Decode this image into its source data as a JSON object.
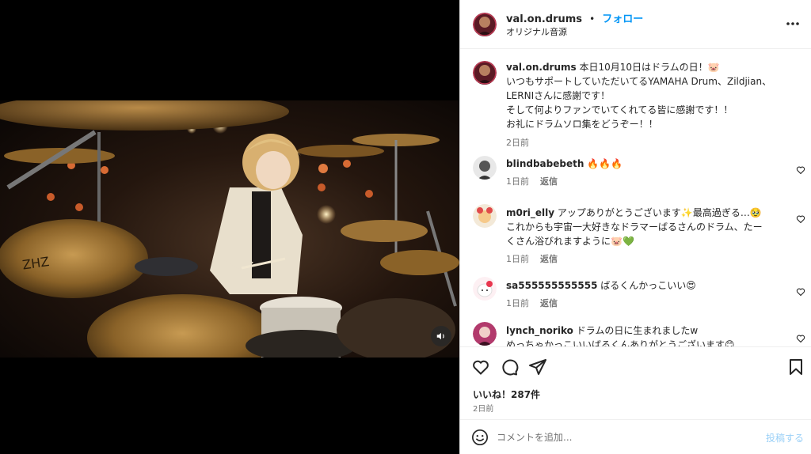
{
  "header": {
    "username": "val.on.drums",
    "dot": "•",
    "follow_label": "フォロー",
    "audio_label": "オリジナル音源"
  },
  "caption": {
    "username": "val.on.drums",
    "lines": [
      "本日10月10日はドラムの日！🐷",
      "いつもサポートしていただいてるYAMAHA Drum、Zildjian、",
      "LERNIさんに感謝です！",
      "そして何よりファンでいてくれてる皆に感謝です！！",
      "お礼にドラムソロ集をどうぞー！！"
    ],
    "time": "2日前"
  },
  "comments": [
    {
      "username": "blindbabebeth",
      "lines": [
        "🔥🔥🔥"
      ],
      "time": "1日前",
      "reply": "返信"
    },
    {
      "username": "m0ri_elly",
      "lines": [
        "アップありがとうございます✨最高過ぎる…🥹",
        "これからも宇宙一大好きなドラマーばるさんのドラム、たー",
        "くさん浴びれますように🐷💚"
      ],
      "time": "1日前",
      "reply": "返信"
    },
    {
      "username": "sa555555555555",
      "lines": [
        "ばるくんかっこいい😍"
      ],
      "time": "1日前",
      "reply": "返信"
    },
    {
      "username": "lynch_noriko",
      "lines": [
        "ドラムの日に生まれましたw",
        "めっちゃかっこいいばるくんありがとうございます😊"
      ],
      "time": "",
      "reply": ""
    }
  ],
  "post": {
    "likes": "いいね！287件",
    "date": "2日前"
  },
  "composer": {
    "placeholder": "コメントを追加...",
    "post_label": "投稿する"
  },
  "video": {
    "cymbal_logo": "ZHZ"
  },
  "icons": {
    "like": "heart-icon",
    "comment": "comment-icon",
    "share": "paper-plane-icon",
    "save": "bookmark-icon",
    "more": "more-options-icon",
    "emoji": "emoji-icon",
    "mute": "speaker-icon"
  },
  "colors": {
    "accent": "#0095f6",
    "post_disabled": "#9ad0f7",
    "muted_text": "#737373",
    "text": "#262626"
  }
}
